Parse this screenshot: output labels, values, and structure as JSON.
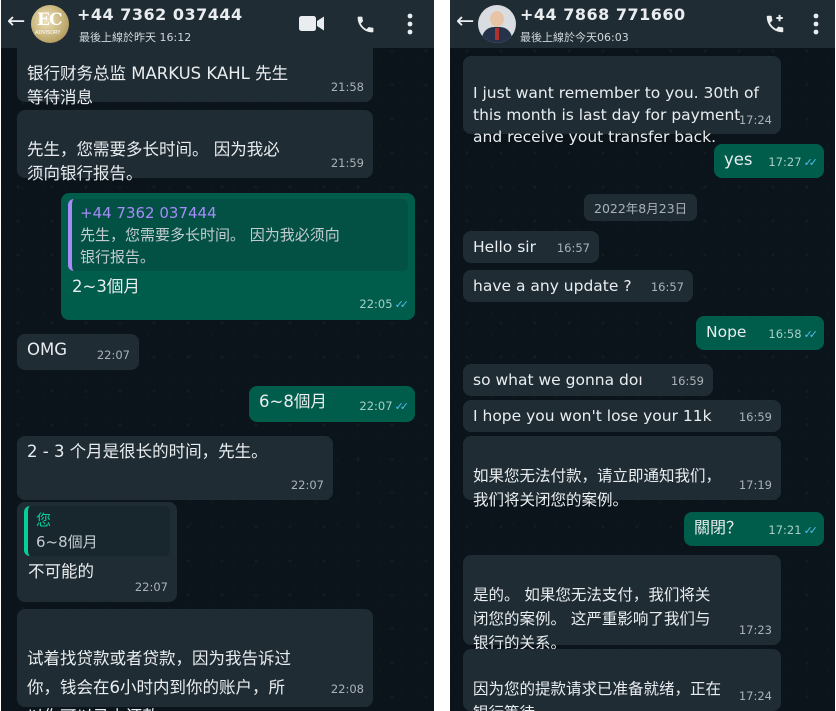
{
  "left_chat": {
    "contact": "+44 7362 037444",
    "status": "最後上線於昨天 16:12",
    "avatar_text": "EC",
    "avatar_subtext": "ADVISORY",
    "messages": [
      {
        "text": "银行财务总监 MARKUS KAHL 先生\n等待消息",
        "time": "21:58"
      },
      {
        "text": "先生，您需要多长时间。 因为我必\n须向银行报告。",
        "time": "21:59"
      },
      {
        "quote_name": "+44 7362 037444",
        "quote_text": "先生，您需要多长时间。 因为我必须向\n银行报告。",
        "text": "2~3個月",
        "time": "22:05"
      },
      {
        "text": "OMG",
        "time": "22:07"
      },
      {
        "text": "6~8個月",
        "time": "22:07"
      },
      {
        "text": "2 - 3 个月是很长的时间，先生。",
        "time": "22:07"
      },
      {
        "quote_name": "您",
        "quote_text": "6~8個月",
        "text": "不可能的",
        "time": "22:07"
      },
      {
        "text": "试着找贷款或者贷款，因为我告诉过\n你，钱会在6小时内到你的账户，所\n以你可以马上还款",
        "time": "22:08"
      }
    ]
  },
  "right_chat": {
    "contact": "+44 7868 771660",
    "status": "最後上線於今天06:03",
    "date_chip": "2022年8月23日",
    "messages": [
      {
        "text": "I just want remember to you. 30th of\nthis month is last day for payment\nand receive yout transfer back.",
        "time": "17:24"
      },
      {
        "text": "yes",
        "time": "17:27"
      },
      {
        "text": "Hello sir",
        "time": "16:57"
      },
      {
        "text": "have a any update ?",
        "time": "16:57"
      },
      {
        "text": "Nope",
        "time": "16:58"
      },
      {
        "text": "so what we gonna doı",
        "time": "16:59"
      },
      {
        "text": "I hope you won't lose your 11k",
        "time": "16:59"
      },
      {
        "text": "如果您无法付款，请立即通知我们，\n我们将关闭您的案例。",
        "time": "17:19"
      },
      {
        "text": "關閉？",
        "time": "17:21"
      },
      {
        "text": "是的。 如果您无法支付，我们将关\n闭您的案例。 这严重影响了我们与\n银行的关系。",
        "time": "17:23"
      },
      {
        "text": "因为您的提款请求已准备就绪，正在\n银行等待。",
        "time": "17:24"
      }
    ]
  },
  "icons": {
    "back": "arrow-left-icon",
    "video": "video-camera-icon",
    "call": "phone-icon",
    "add_call": "add-call-icon",
    "menu": "more-vertical-icon",
    "read": "double-check-icon"
  },
  "colors": {
    "background": "#0b141a",
    "header": "#1f2c34",
    "incoming": "#1f2c34",
    "outgoing": "#005c4b",
    "read_tick": "#53bdeb",
    "quote_self": "#a78bfa",
    "quote_you": "#06cf9c"
  }
}
